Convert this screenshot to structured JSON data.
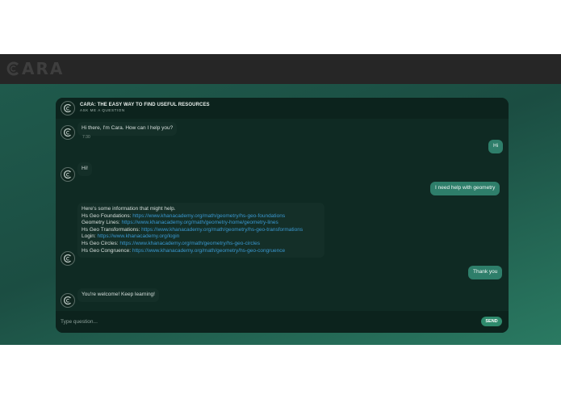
{
  "app": {
    "logo_text": "ARA"
  },
  "header": {
    "title": "CARA: THE EASY WAY TO FIND USEFUL RESOURCES",
    "subtitle": "ASK ME A QUESTION"
  },
  "messages": {
    "bot1": "Hi there, I'm Cara. How can I help you?",
    "bot1_time": "7:30",
    "user1": "Hi",
    "bot2": "Hi!",
    "user2": "I need help with geometry",
    "bot3_intro": "Here's some information that might help.",
    "bot3_lines": [
      {
        "label": "Hs Geo Foundations: ",
        "url": "https://www.khanacademy.org/math/geometry/hs-geo-foundations"
      },
      {
        "label": "Geometry Lines: ",
        "url": "https://www.khanacademy.org/math/geometry-home/geometry-lines"
      },
      {
        "label": "Hs Geo Transformations: ",
        "url": "https://www.khanacademy.org/math/geometry/hs-geo-transformations"
      },
      {
        "label": "Login: ",
        "url": "https://www.khanacademy.org/login"
      },
      {
        "label": "Hs Geo Circles: ",
        "url": "https://www.khanacademy.org/math/geometry/hs-geo-circles"
      },
      {
        "label": "Hs Geo Congruence: ",
        "url": "https://www.khanacademy.org/math/geometry/hs-geo-congruence"
      }
    ],
    "user3": "Thank you",
    "bot4": "You're welcome! Keep learning!"
  },
  "input": {
    "placeholder": "Type question...",
    "send_label": "SEND"
  },
  "colors": {
    "topbar": "#262626",
    "chat_bg": "#0f2a23",
    "user_bubble": "#2e7e6a",
    "bot_bubble": "#142f28",
    "link": "#3a98d1",
    "send_button": "#2e8a6c"
  }
}
